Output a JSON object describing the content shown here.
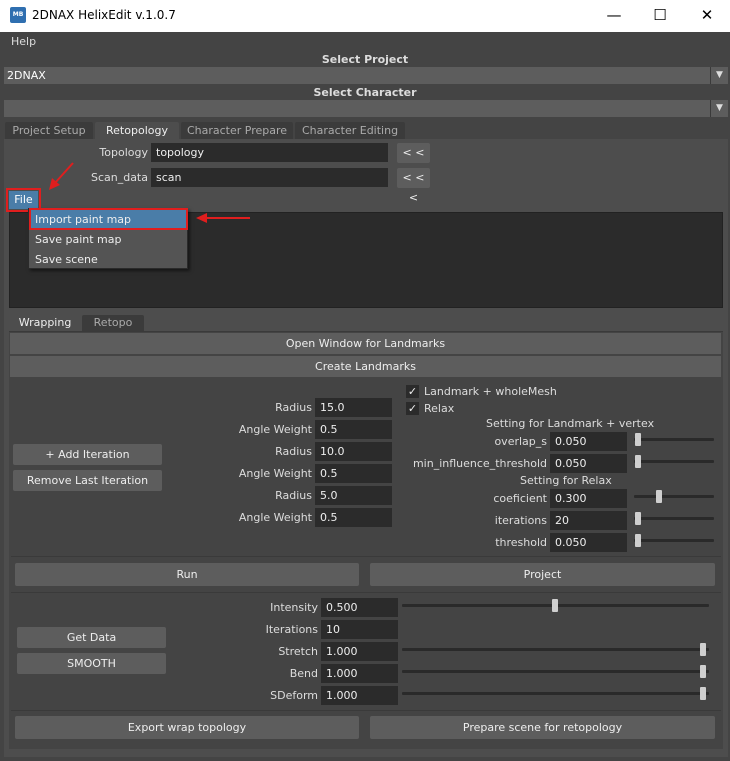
{
  "window": {
    "title": "2DNAX HelixEdit v.1.0.7",
    "icon_label": "MB",
    "minimize": "—",
    "maximize": "☐",
    "close": "✕"
  },
  "menu": {
    "help": "Help"
  },
  "project": {
    "label": "Select Project",
    "value": "2DNAX"
  },
  "character": {
    "label": "Select Character",
    "value": ""
  },
  "dropdown_arrow": "▼",
  "main_tabs": [
    "Project Setup",
    "Retopology",
    "Character Prepare",
    "Character Editing"
  ],
  "retopology": {
    "topology_label": "Topology",
    "topology_value": "topology",
    "scan_label": "Scan_data",
    "scan_value": "scan",
    "load_button": "< < <",
    "file_button": "File",
    "file_menu": [
      "Import paint map",
      "Save paint map",
      "Save scene"
    ]
  },
  "sub_tabs": [
    "Wrapping",
    "Retopo"
  ],
  "wrapping": {
    "open_landmarks": "Open Window for Landmarks",
    "create_landmarks": "Create Landmarks",
    "add_iteration": "+ Add Iteration",
    "remove_iteration": "Remove Last Iteration",
    "iterations": [
      {
        "radius_label": "Radius",
        "radius": "15.0",
        "angle_label": "Angle Weight",
        "angle": "0.5"
      },
      {
        "radius_label": "Radius",
        "radius": "10.0",
        "angle_label": "Angle Weight",
        "angle": "0.5"
      },
      {
        "radius_label": "Radius",
        "radius": "5.0",
        "angle_label": "Angle Weight",
        "angle": "0.5"
      }
    ],
    "landmark_whole_mesh": {
      "label": "Landmark + wholeMesh",
      "checked": true
    },
    "relax": {
      "label": "Relax",
      "checked": true
    },
    "checkmark": "✓",
    "landmark_vertex_header": "Setting for Landmark + vertex",
    "overlap": {
      "label": "overlap_s",
      "value": "0.050",
      "level": 0.0
    },
    "min_influence": {
      "label": "min_influence_threshold",
      "value": "0.050",
      "level": 0.0
    },
    "relax_header": "Setting for Relax",
    "coeficient": {
      "label": "coeficient",
      "value": "0.300",
      "level": 0.3
    },
    "iterations_setting": {
      "label": "iterations",
      "value": "20",
      "level": 0.0
    },
    "threshold": {
      "label": "threshold",
      "value": "0.050",
      "level": 0.0
    },
    "run": "Run",
    "project": "Project"
  },
  "smooth": {
    "get_data": "Get Data",
    "smooth": "SMOOTH",
    "intensity": {
      "label": "Intensity",
      "value": "0.500",
      "level": 0.5
    },
    "iterations": {
      "label": "Iterations",
      "value": "10"
    },
    "stretch": {
      "label": "Stretch",
      "value": "1.000",
      "level": 1.0
    },
    "bend": {
      "label": "Bend",
      "value": "1.000",
      "level": 1.0
    },
    "sdeform": {
      "label": "SDeform",
      "value": "1.000",
      "level": 1.0
    }
  },
  "bottom": {
    "export_wrap": "Export wrap topology",
    "prepare_scene": "Prepare scene for retopology"
  },
  "colors": {
    "accent": "#4a7da8",
    "annotation": "#e01e1e"
  }
}
